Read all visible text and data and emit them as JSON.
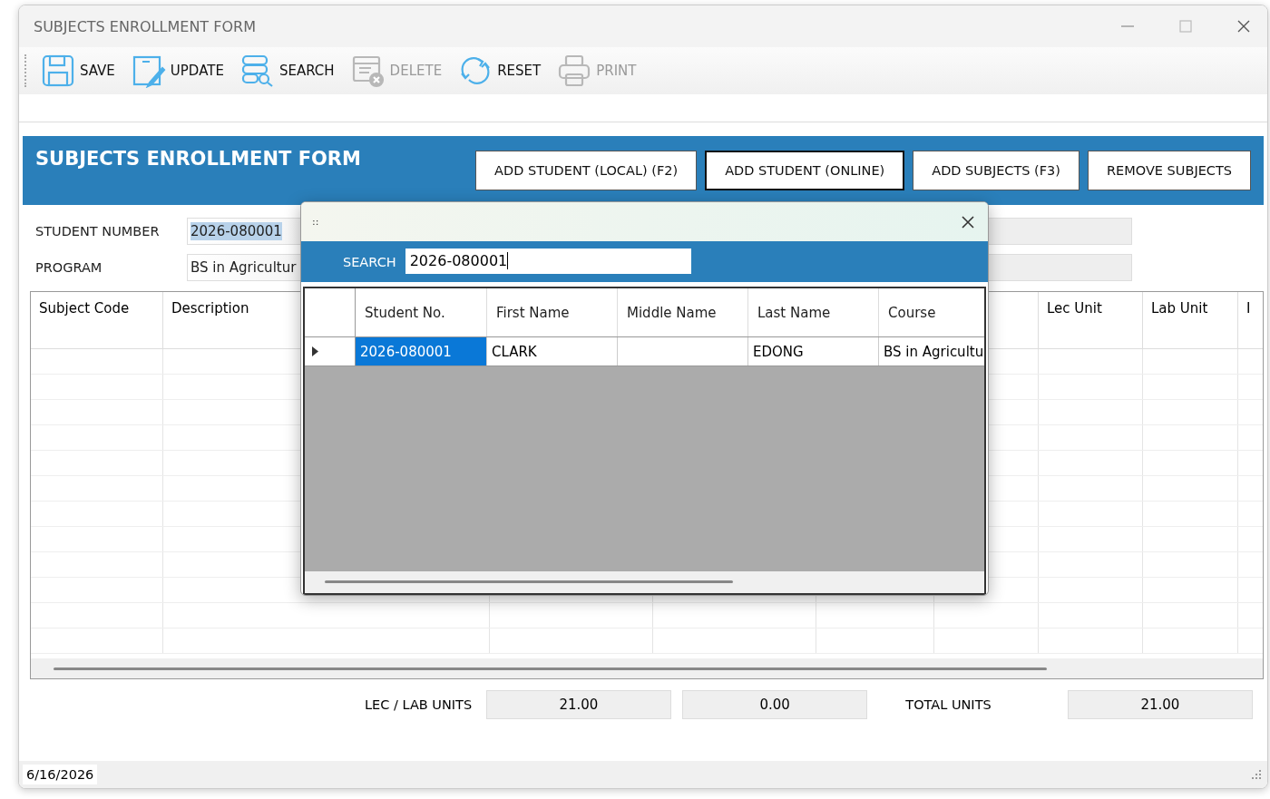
{
  "window": {
    "title": "SUBJECTS ENROLLMENT FORM"
  },
  "toolbar": [
    {
      "label": "SAVE",
      "disabled": false
    },
    {
      "label": "UPDATE",
      "disabled": false
    },
    {
      "label": "SEARCH",
      "disabled": false
    },
    {
      "label": "DELETE",
      "disabled": true
    },
    {
      "label": "RESET",
      "disabled": false
    },
    {
      "label": "PRINT",
      "disabled": true
    }
  ],
  "header": {
    "title": "SUBJECTS ENROLLMENT FORM",
    "buttons": [
      {
        "label": "ADD STUDENT (LOCAL) (F2)",
        "focused": false
      },
      {
        "label": "ADD STUDENT (ONLINE)",
        "focused": true
      },
      {
        "label": "ADD SUBJECTS (F3)",
        "focused": false
      },
      {
        "label": "REMOVE SUBJECTS",
        "focused": false
      }
    ]
  },
  "fields": [
    {
      "label": "STUDENT NUMBER",
      "value": "2026-080001",
      "value_selected": true
    },
    {
      "label": "PROGRAM",
      "value": "BS in Agricultur",
      "value_selected": false
    }
  ],
  "grid": {
    "columns": [
      "Subject Code",
      "Description",
      "Lec Unit",
      "Lab Unit",
      "I"
    ]
  },
  "totals": {
    "label": "LEC / LAB UNITS",
    "lec": "21.00",
    "lab": "0.00",
    "total_label": "TOTAL UNITS",
    "total": "21.00"
  },
  "status_bar": {
    "date": "6/16/2026"
  },
  "popup": {
    "grip": "::",
    "search_label": "SEARCH",
    "search_value": "2026-080001",
    "columns": [
      "Student No.",
      "First Name",
      "Middle Name",
      "Last Name",
      "Course"
    ],
    "rows": [
      {
        "current": true,
        "selected": true,
        "cells": [
          "2026-080001",
          "CLARK",
          "",
          "EDONG",
          "BS in Agricultu"
        ]
      }
    ]
  }
}
